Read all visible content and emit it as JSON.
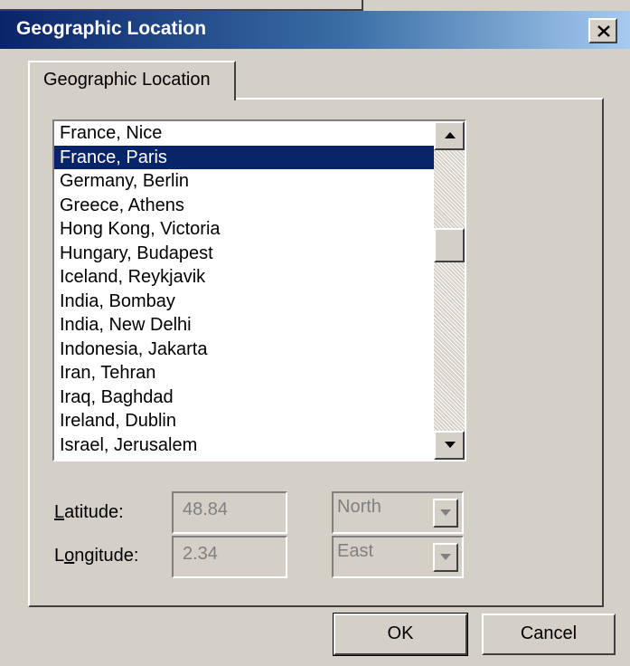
{
  "window": {
    "title": "Geographic Location"
  },
  "tabs": [
    {
      "label": "Geographic Location"
    }
  ],
  "locations": [
    "France, Nice",
    "France, Paris",
    "Germany, Berlin",
    "Greece, Athens",
    "Hong Kong, Victoria",
    "Hungary, Budapest",
    "Iceland, Reykjavik",
    "India, Bombay",
    "India, New Delhi",
    "Indonesia, Jakarta",
    "Iran, Tehran",
    "Iraq, Baghdad",
    "Ireland, Dublin",
    "Israel, Jerusalem"
  ],
  "selected_location": "France, Paris",
  "latitude": {
    "label_first": "L",
    "label_rest": "atitude:",
    "value": "48.84",
    "direction": "North"
  },
  "longitude": {
    "label_pre": "L",
    "label_mnemonic": "o",
    "label_rest": "ngitude:",
    "value": "2.34",
    "direction": "East"
  },
  "buttons": {
    "ok": "OK",
    "cancel": "Cancel"
  },
  "icons": {
    "close": "close-icon",
    "scroll_up": "arrow-up-icon",
    "scroll_down": "arrow-down-icon",
    "dropdown": "chevron-down-icon"
  }
}
